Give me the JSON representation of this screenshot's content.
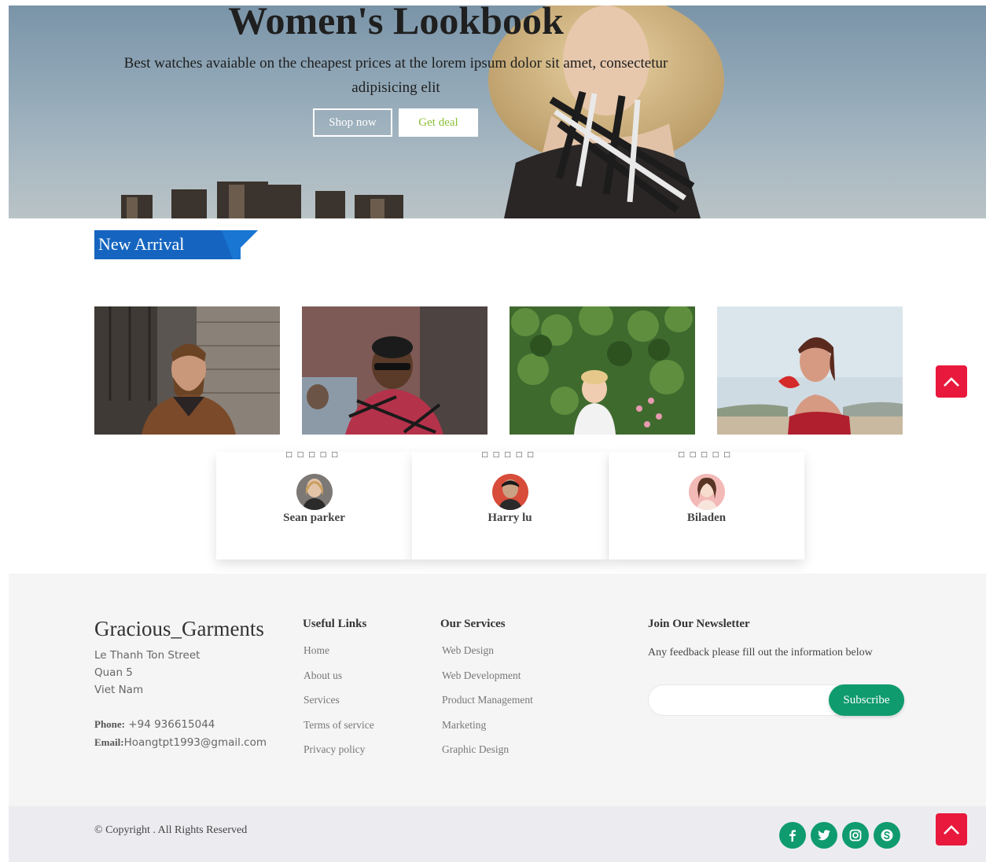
{
  "hero": {
    "title": "Women's Lookbook",
    "subtitle": "Best watches avaiable on the cheapest prices at the lorem ipsum dolor sit amet, consectetur adipisicing elit",
    "shop_label": "Shop now",
    "deal_label": "Get deal"
  },
  "new_arrival": {
    "label": "New Arrival",
    "products": [
      {
        "name": "bearded man in sherpa jacket"
      },
      {
        "name": "man in sunglasses and plaid shirt"
      },
      {
        "name": "toddler boy in garden"
      },
      {
        "name": "woman in red off-shoulder top"
      }
    ]
  },
  "testimonials": [
    {
      "stars": "□□□□□",
      "name": "Sean parker"
    },
    {
      "stars": "□□□□□",
      "name": "Harry lu"
    },
    {
      "stars": "□□□□□",
      "name": "Biladen"
    }
  ],
  "footer": {
    "brand": "Gracious_Garments",
    "address": [
      "Le Thanh Ton Street",
      "Quan 5",
      "Viet Nam"
    ],
    "phone_label": "Phone:",
    "phone": " +94 936615044",
    "email_label": "Email:",
    "email": "Hoangtpt1993@gmail.com",
    "useful_links": {
      "title": "Useful Links",
      "items": [
        "Home",
        "About us",
        "Services",
        "Terms of service",
        "Privacy policy"
      ]
    },
    "services": {
      "title": "Our Services",
      "items": [
        "Web Design",
        "Web Development",
        "Product Management",
        "Marketing",
        "Graphic Design"
      ]
    },
    "newsletter": {
      "title": "Join Our Newsletter",
      "desc": "Any feedback please fill out the information below",
      "input_value": "",
      "subscribe_label": "Subscribe"
    },
    "copyright": "© Copyright . All Rights Reserved"
  },
  "social": [
    "facebook-icon",
    "twitter-icon",
    "instagram-icon",
    "skype-icon"
  ],
  "colors": {
    "accent_green": "#0f9b6e",
    "tag_blue": "#1565c0",
    "scroll_top_red": "#e8193c",
    "deal_text_green": "#8bbf3a"
  }
}
